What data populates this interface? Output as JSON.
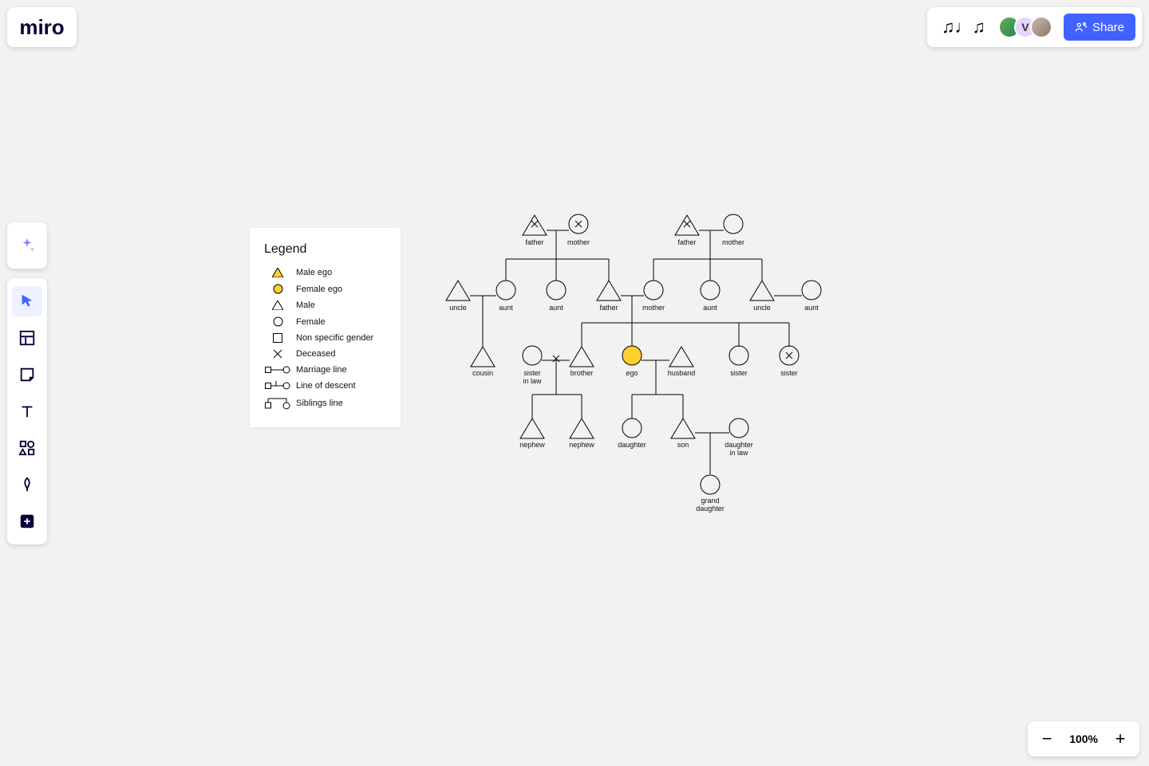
{
  "brand": "miro",
  "share_label": "Share",
  "avatar_initial": "V",
  "zoom_level": "100%",
  "legend": {
    "title": "Legend",
    "items": {
      "male_ego": "Male ego",
      "female_ego": "Female ego",
      "male": "Male",
      "female": "Female",
      "nonspecific": "Non specific gender",
      "deceased": "Deceased",
      "marriage": "Marriage line",
      "descent": "Line of descent",
      "siblings": "Siblings line"
    }
  },
  "labels": {
    "g0_father_l": "father",
    "g0_mother_l": "mother",
    "g0_father_r": "father",
    "g0_mother_r": "mother",
    "g1_uncle_l": "uncle",
    "g1_aunt_l1": "aunt",
    "g1_aunt_l2": "aunt",
    "g1_father": "father",
    "g1_mother": "mother",
    "g1_aunt_r": "aunt",
    "g1_uncle_r": "uncle",
    "g1_aunt_r2": "aunt",
    "g2_cousin": "cousin",
    "g2_sisterinlaw": "sister\nin law",
    "g2_brother": "brother",
    "g2_ego": "ego",
    "g2_husband": "husband",
    "g2_sister1": "sister",
    "g2_sister2": "sister",
    "g3_nephew1": "nephew",
    "g3_nephew2": "nephew",
    "g3_daughter": "daughter",
    "g3_son": "son",
    "g3_daughterinlaw": "daughter\nin law",
    "g4_gd": "grand\ndaughter"
  }
}
